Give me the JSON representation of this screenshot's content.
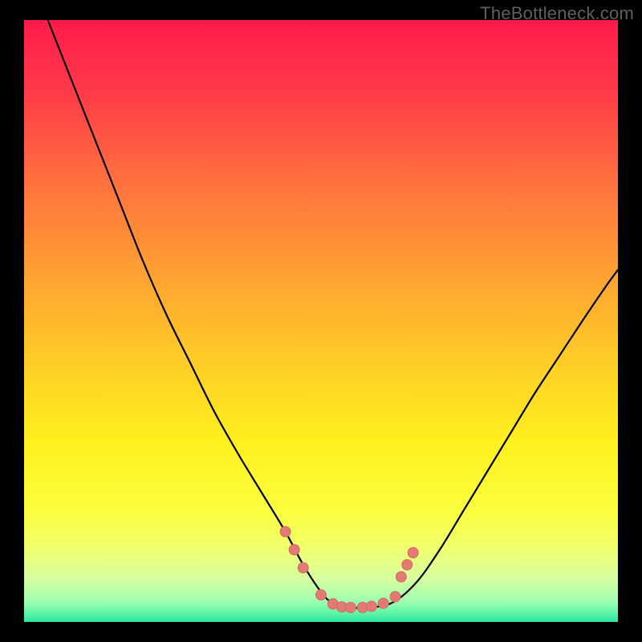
{
  "watermark": "TheBottleneck.com",
  "colors": {
    "frame": "#000000",
    "curve": "#000000",
    "marker_fill": "#e37a74",
    "marker_stroke": "#d46a64",
    "gradient_stops": [
      {
        "offset": 0.0,
        "color": "#ff1b4b"
      },
      {
        "offset": 0.12,
        "color": "#ff3a49"
      },
      {
        "offset": 0.25,
        "color": "#ff6a3f"
      },
      {
        "offset": 0.4,
        "color": "#ff9a34"
      },
      {
        "offset": 0.55,
        "color": "#ffc828"
      },
      {
        "offset": 0.7,
        "color": "#fff01e"
      },
      {
        "offset": 0.82,
        "color": "#fbff40"
      },
      {
        "offset": 0.88,
        "color": "#f0ff70"
      },
      {
        "offset": 0.93,
        "color": "#d5ffa0"
      },
      {
        "offset": 0.965,
        "color": "#a0ffb0"
      },
      {
        "offset": 0.985,
        "color": "#60f5a8"
      },
      {
        "offset": 1.0,
        "color": "#28e89c"
      }
    ]
  },
  "chart_data": {
    "type": "line",
    "title": "",
    "xlabel": "",
    "ylabel": "",
    "xlim": [
      0,
      100
    ],
    "ylim": [
      0,
      100
    ],
    "x": [
      4,
      8,
      12,
      16,
      20,
      24,
      28,
      32,
      36,
      40,
      44,
      47,
      50,
      52,
      55,
      58,
      62,
      66,
      70,
      74,
      78,
      82,
      86,
      90,
      94,
      98,
      100
    ],
    "values": [
      100,
      90,
      80,
      70,
      60,
      51,
      43,
      35,
      28,
      21.5,
      15,
      9.5,
      5,
      3.1,
      2.4,
      2.4,
      3.2,
      6.5,
      12,
      18.5,
      25,
      31.5,
      38,
      44,
      50,
      55.8,
      58.5
    ],
    "markers": [
      {
        "x": 44.0,
        "y": 15.0
      },
      {
        "x": 45.5,
        "y": 12.0
      },
      {
        "x": 47.0,
        "y": 9.0
      },
      {
        "x": 50.0,
        "y": 4.5
      },
      {
        "x": 52.0,
        "y": 3.0
      },
      {
        "x": 53.5,
        "y": 2.5
      },
      {
        "x": 55.0,
        "y": 2.4
      },
      {
        "x": 57.0,
        "y": 2.4
      },
      {
        "x": 58.5,
        "y": 2.6
      },
      {
        "x": 60.5,
        "y": 3.1
      },
      {
        "x": 62.5,
        "y": 4.2
      },
      {
        "x": 63.5,
        "y": 7.5
      },
      {
        "x": 64.5,
        "y": 9.5
      },
      {
        "x": 65.5,
        "y": 11.5
      }
    ]
  }
}
